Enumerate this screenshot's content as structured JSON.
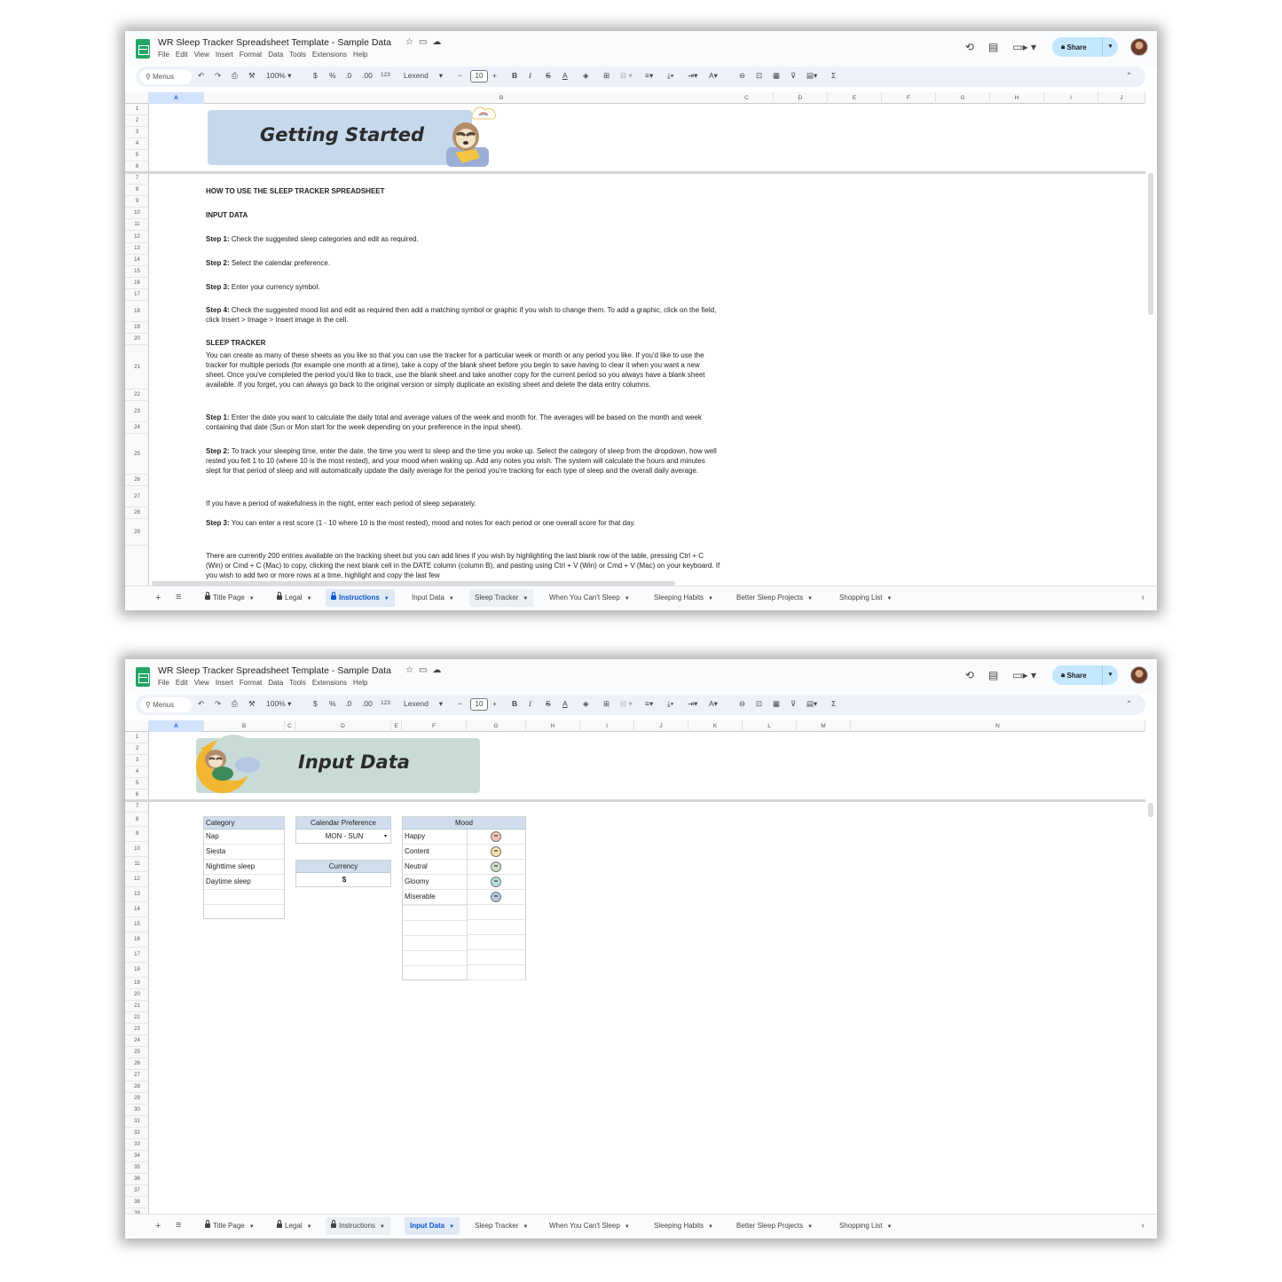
{
  "doc_title": "WR Sleep Tracker Spreadsheet Template - Sample Data",
  "menus": [
    "File",
    "Edit",
    "View",
    "Insert",
    "Format",
    "Data",
    "Tools",
    "Extensions",
    "Help"
  ],
  "share_label": "Share",
  "toolbar": {
    "search": "Menus",
    "zoom": "100%",
    "currency": "$",
    "percent": "%",
    "dec_less": ".0",
    "dec_more": ".00",
    "number_format": "123",
    "font": "Lexend",
    "font_size": "10",
    "bold": "B",
    "italic": "I",
    "strike": "S",
    "text_color": "A",
    "sum": "Σ"
  },
  "tabs": [
    "Title Page",
    "Legal",
    "Instructions",
    "Input Data",
    "Sleep Tracker",
    "When You Can't Sleep",
    "Sleeping Habits",
    "Better Sleep Projects",
    "Shopping List"
  ],
  "window1": {
    "columns": [
      "A",
      "B",
      "C",
      "D",
      "E",
      "F",
      "G",
      "H",
      "I",
      "J"
    ],
    "banner_title": "Getting Started",
    "active_tab": "Instructions",
    "instructions": {
      "heading": "HOW TO USE THE SLEEP TRACKER SPREADSHEET",
      "input_heading": "INPUT DATA",
      "input_steps": [
        {
          "label": "Step 1:",
          "text": " Check the suggested sleep categories and edit as required."
        },
        {
          "label": "Step 2:",
          "text": " Select the calendar preference."
        },
        {
          "label": "Step 3:",
          "text": " Enter your currency symbol."
        },
        {
          "label": "Step 4:",
          "text": " Check the suggested mood list and edit as required then add a matching symbol or graphic if you wish to change them. To add a graphic, click on the field, click Insert > Image > Insert image in the cell."
        }
      ],
      "tracker_heading": "SLEEP TRACKER",
      "tracker_intro": "You can create as many of these sheets as you like so that you can use the tracker for a particular week or month or any period you like. If you'd like to use the tracker for multiple periods (for example one month at a time), take a copy of the blank sheet before you begin to save having to clear it when you want a new sheet.  Once you've completed the period you'd like to track, use the blank sheet and take another copy for the current period so you always have a blank sheet available. If you forget, you can always go back to the original version or simply duplicate an existing sheet and delete the data entry columns.",
      "tracker_steps": [
        {
          "label": "Step 1:",
          "text": " Enter the date you want to calculate the daily total and average values of the week and month for. The averages will be based on the month and week containing that date (Sun or Mon start for the week depending on your preference in the input sheet)."
        },
        {
          "label": "Step 2:",
          "text": " To track your sleeping time, enter the date, the time you went to sleep and the time you woke up. Select the category of sleep from the dropdown, how well rested you felt 1 to 10 (where 10 is the most rested), and your mood when waking up. Add any notes you wish. The system will calculate the hours and minutes slept for that period of sleep and will automatically update the daily average for the period you're tracking for each type of sleep and the overall daily average."
        },
        {
          "label": "",
          "text": "If you have a period of wakefulness in the night, enter each period of sleep separately."
        },
        {
          "label": "Step 3:",
          "text": " You can enter a rest score (1 - 10 where 10 is the most rested), mood and notes for each period or one overall score for that day."
        }
      ],
      "entries_note": "There are currently 200 entries available on the tracking sheet but you can add lines if you wish by highlighting the last blank row of the table, pressing Ctrl + C (Win) or Cmd + C (Mac) to copy, clicking the next blank cell in the DATE column (column B), and pasting using Ctrl + V (Win) or Cmd + V (Mac) on your keyboard. If you wish to add two or more rows at a time, highlight and copy the last few"
    }
  },
  "window2": {
    "columns": [
      "A",
      "B",
      "C",
      "D",
      "E",
      "F",
      "G",
      "H",
      "I",
      "J",
      "K",
      "L",
      "M",
      "N"
    ],
    "banner_title": "Input Data",
    "active_tab": "Input Data",
    "category": {
      "header": "Category",
      "items": [
        "Nap",
        "Siesta",
        "Nighttime sleep",
        "Daytime sleep"
      ]
    },
    "calendar": {
      "header": "Calendar Preference",
      "value": "MON - SUN"
    },
    "currency": {
      "header": "Currency",
      "value": "$"
    },
    "mood": {
      "header": "Mood",
      "items": [
        {
          "name": "Happy",
          "color": "#f4c2b8"
        },
        {
          "name": "Content",
          "color": "#f6e2a8"
        },
        {
          "name": "Neutral",
          "color": "#c9e2c4"
        },
        {
          "name": "Gloomy",
          "color": "#b8dde0"
        },
        {
          "name": "Miserable",
          "color": "#b9c6e3"
        }
      ]
    }
  }
}
